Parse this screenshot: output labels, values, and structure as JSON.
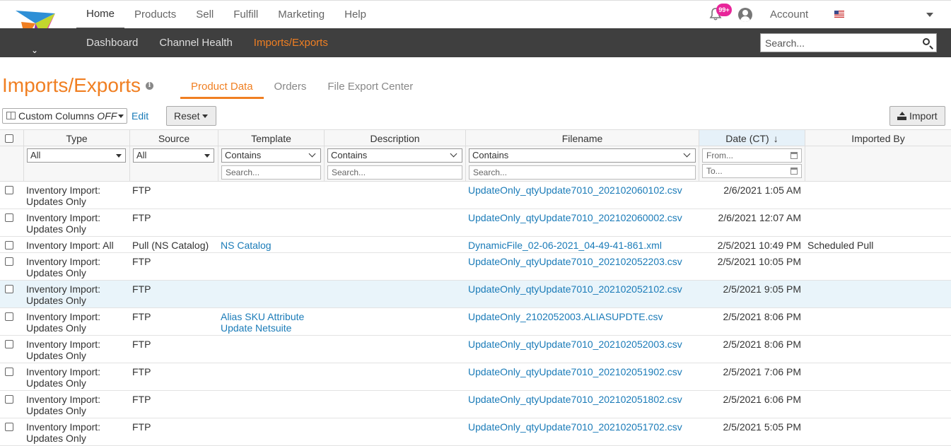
{
  "topnav": {
    "items": [
      "Home",
      "Products",
      "Sell",
      "Fulfill",
      "Marketing",
      "Help"
    ],
    "notification_badge": "99+",
    "account_label": "Account"
  },
  "subnav": {
    "items": [
      "Dashboard",
      "Channel Health",
      "Imports/Exports"
    ],
    "search_placeholder": "Search..."
  },
  "page": {
    "title": "Imports/Exports",
    "tabs": [
      "Product Data",
      "Orders",
      "File Export Center"
    ]
  },
  "toolbar": {
    "custom_columns_label": "Custom Columns",
    "custom_columns_state": "OFF",
    "edit_label": "Edit",
    "reset_label": "Reset",
    "import_label": "Import"
  },
  "table": {
    "headers": [
      "Type",
      "Source",
      "Template",
      "Description",
      "Filename",
      "Date (CT)",
      "Imported By"
    ],
    "sort_arrow": "↓",
    "filters": {
      "type": "All",
      "source": "All",
      "template": "Contains",
      "description": "Contains",
      "filename": "Contains",
      "search_placeholder": "Search...",
      "date_from": "From...",
      "date_to": "To..."
    },
    "rows": [
      {
        "type1": "Inventory Import:",
        "type2": "Updates Only",
        "source": "FTP",
        "template1": "",
        "template2": "",
        "filename": "UpdateOnly_qtyUpdate7010_202102060102.csv",
        "date": "2/6/2021 1:05 AM",
        "imported_by": ""
      },
      {
        "type1": "Inventory Import:",
        "type2": "Updates Only",
        "source": "FTP",
        "template1": "",
        "template2": "",
        "filename": "UpdateOnly_qtyUpdate7010_202102060002.csv",
        "date": "2/6/2021 12:07 AM",
        "imported_by": ""
      },
      {
        "type1": "Inventory Import: All",
        "type2": "",
        "source": "Pull (NS Catalog)",
        "template1": "NS Catalog",
        "template2": "",
        "filename": "DynamicFile_02-06-2021_04-49-41-861.xml",
        "date": "2/5/2021 10:49 PM",
        "imported_by": "Scheduled Pull"
      },
      {
        "type1": "Inventory Import:",
        "type2": "Updates Only",
        "source": "FTP",
        "template1": "",
        "template2": "",
        "filename": "UpdateOnly_qtyUpdate7010_202102052203.csv",
        "date": "2/5/2021 10:05 PM",
        "imported_by": ""
      },
      {
        "type1": "Inventory Import:",
        "type2": "Updates Only",
        "source": "FTP",
        "template1": "",
        "template2": "",
        "filename": "UpdateOnly_qtyUpdate7010_202102052102.csv",
        "date": "2/5/2021 9:05 PM",
        "imported_by": ""
      },
      {
        "type1": "Inventory Import:",
        "type2": "Updates Only",
        "source": "FTP",
        "template1": "Alias SKU Attribute",
        "template2": "Update Netsuite",
        "filename": "UpdateOnly_2102052003.ALIASUPDTE.csv",
        "date": "2/5/2021 8:06 PM",
        "imported_by": ""
      },
      {
        "type1": "Inventory Import:",
        "type2": "Updates Only",
        "source": "FTP",
        "template1": "",
        "template2": "",
        "filename": "UpdateOnly_qtyUpdate7010_202102052003.csv",
        "date": "2/5/2021 8:06 PM",
        "imported_by": ""
      },
      {
        "type1": "Inventory Import:",
        "type2": "Updates Only",
        "source": "FTP",
        "template1": "",
        "template2": "",
        "filename": "UpdateOnly_qtyUpdate7010_202102051902.csv",
        "date": "2/5/2021 7:06 PM",
        "imported_by": ""
      },
      {
        "type1": "Inventory Import:",
        "type2": "Updates Only",
        "source": "FTP",
        "template1": "",
        "template2": "",
        "filename": "UpdateOnly_qtyUpdate7010_202102051802.csv",
        "date": "2/5/2021 6:06 PM",
        "imported_by": ""
      },
      {
        "type1": "Inventory Import:",
        "type2": "Updates Only",
        "source": "FTP",
        "template1": "",
        "template2": "",
        "filename": "UpdateOnly_qtyUpdate7010_202102051702.csv",
        "date": "2/5/2021 5:05 PM",
        "imported_by": ""
      }
    ]
  },
  "colors": {
    "accent": "#f07f22",
    "link": "#1a7bb8",
    "subnav_bg": "#3f3f3f",
    "badge": "#e8259a",
    "row_highlight": "#e9f4fa"
  }
}
